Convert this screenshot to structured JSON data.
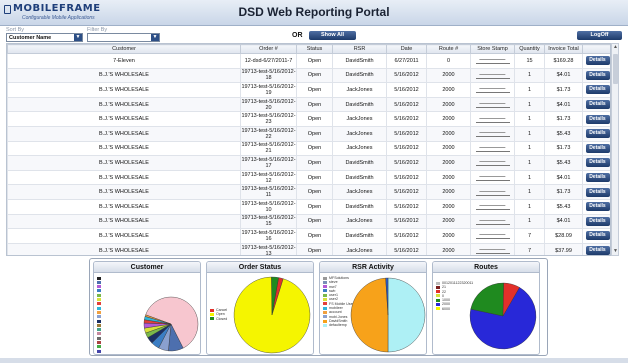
{
  "header": {
    "logo_text": "MOBILEFRAME",
    "logo_tagline": "Configurable Mobile Applications",
    "title": "DSD Web Reporting Portal"
  },
  "controls": {
    "sort_label": "Sort By",
    "sort_value": "Customer Name",
    "filter_label": "Filter By",
    "filter_value": "",
    "or_label": "OR",
    "show_all": "Show All",
    "logoff": "LogOff"
  },
  "table": {
    "columns": [
      "Customer",
      "Order #",
      "Status",
      "RSR",
      "Date",
      "Route #",
      "Store Stamp",
      "Quantity",
      "Invoice Total",
      ""
    ],
    "rows": [
      {
        "customer": "7-Eleven",
        "order": "12-dsd-6/27/2011-7",
        "status": "Open",
        "rsr": "DavidSmith",
        "date": "6/27/2011",
        "route": "0",
        "qty": "15",
        "total": "$169.28"
      },
      {
        "customer": "B.J.'S WHOLESALE",
        "order": "19713-test-5/16/2012-18",
        "status": "Open",
        "rsr": "DavidSmith",
        "date": "5/16/2012",
        "route": "2000",
        "qty": "1",
        "total": "$4.01"
      },
      {
        "customer": "B.J.'S WHOLESALE",
        "order": "19713-test-5/16/2012-19",
        "status": "Open",
        "rsr": "JackJones",
        "date": "5/16/2012",
        "route": "2000",
        "qty": "1",
        "total": "$1.73"
      },
      {
        "customer": "B.J.'S WHOLESALE",
        "order": "19713-test-5/16/2012-20",
        "status": "Open",
        "rsr": "DavidSmith",
        "date": "5/16/2012",
        "route": "2000",
        "qty": "1",
        "total": "$4.01"
      },
      {
        "customer": "B.J.'S WHOLESALE",
        "order": "19713-test-5/16/2012-23",
        "status": "Open",
        "rsr": "JackJones",
        "date": "5/16/2012",
        "route": "2000",
        "qty": "1",
        "total": "$1.73"
      },
      {
        "customer": "B.J.'S WHOLESALE",
        "order": "19713-test-5/16/2012-22",
        "status": "Open",
        "rsr": "JackJones",
        "date": "5/16/2012",
        "route": "2000",
        "qty": "1",
        "total": "$5.43"
      },
      {
        "customer": "B.J.'S WHOLESALE",
        "order": "19713-test-5/16/2012-21",
        "status": "Open",
        "rsr": "JackJones",
        "date": "5/16/2012",
        "route": "2000",
        "qty": "1",
        "total": "$1.73"
      },
      {
        "customer": "B.J.'S WHOLESALE",
        "order": "19713-test-5/16/2012-17",
        "status": "Open",
        "rsr": "DavidSmith",
        "date": "5/16/2012",
        "route": "2000",
        "qty": "1",
        "total": "$5.43"
      },
      {
        "customer": "B.J.'S WHOLESALE",
        "order": "19713-test-5/16/2012-12",
        "status": "Open",
        "rsr": "DavidSmith",
        "date": "5/16/2012",
        "route": "2000",
        "qty": "1",
        "total": "$4.01"
      },
      {
        "customer": "B.J.'S WHOLESALE",
        "order": "19713-test-5/16/2012-11",
        "status": "Open",
        "rsr": "JackJones",
        "date": "5/16/2012",
        "route": "2000",
        "qty": "1",
        "total": "$1.73"
      },
      {
        "customer": "B.J.'S WHOLESALE",
        "order": "19713-test-5/16/2012-10",
        "status": "Open",
        "rsr": "DavidSmith",
        "date": "5/16/2012",
        "route": "2000",
        "qty": "1",
        "total": "$5.43"
      },
      {
        "customer": "B.J.'S WHOLESALE",
        "order": "19713-test-5/16/2012-15",
        "status": "Open",
        "rsr": "JackJones",
        "date": "5/16/2012",
        "route": "2000",
        "qty": "1",
        "total": "$4.01"
      },
      {
        "customer": "B.J.'S WHOLESALE",
        "order": "19713-test-5/16/2012-16",
        "status": "Open",
        "rsr": "DavidSmith",
        "date": "5/16/2012",
        "route": "2000",
        "qty": "7",
        "total": "$28.09"
      },
      {
        "customer": "B.J.'S WHOLESALE",
        "order": "19713-test-5/16/2012-13",
        "status": "Open",
        "rsr": "JackJones",
        "date": "5/16/2012",
        "route": "2000",
        "qty": "7",
        "total": "$37.99"
      }
    ],
    "details_label": "Details"
  },
  "charts": {
    "customer": {
      "title": "Customer",
      "slices": [
        {
          "color": "#f7c6cf",
          "value": 62
        },
        {
          "color": "#4d6fae",
          "value": 9
        },
        {
          "color": "#8aa0cf",
          "value": 6
        },
        {
          "color": "#3b7dc4",
          "value": 5
        },
        {
          "color": "#1b2f64",
          "value": 4
        },
        {
          "color": "#7ab84a",
          "value": 3
        },
        {
          "color": "#d7e23a",
          "value": 3
        },
        {
          "color": "#b35ad6",
          "value": 3
        },
        {
          "color": "#e2403a",
          "value": 2
        },
        {
          "color": "#2fb5d9",
          "value": 2
        },
        {
          "color": "#f0a040",
          "value": 1
        }
      ],
      "legend_colors": [
        "#222",
        "#4d6fae",
        "#b35ad6",
        "#3b7dc4",
        "#7ab84a",
        "#d7e23a",
        "#e2403a",
        "#2fb5d9",
        "#f0a040",
        "#8aa0cf",
        "#1b2f64",
        "#9a7b3a",
        "#45a08a",
        "#c48aa0",
        "#6a6a6a",
        "#aa4444",
        "#44aa44",
        "#4444aa",
        "#aaaa44",
        "#44aaaa",
        "#aa44aa",
        "#f7c6cf"
      ]
    },
    "order_status": {
      "title": "Order Status",
      "slices": [
        {
          "label": "Cancel",
          "color": "#e2302a",
          "value": 2
        },
        {
          "label": "Open",
          "color": "#f5f500",
          "value": 95
        },
        {
          "label": "Closed",
          "color": "#1f8a1f",
          "value": 3
        }
      ]
    },
    "rsr_activity": {
      "title": "RSR Activity",
      "slices": [
        {
          "color": "#aef0f5",
          "value": 50
        },
        {
          "color": "#f7a21a",
          "value": 49
        },
        {
          "color": "#2a5ccc",
          "value": 1
        }
      ],
      "legend": [
        {
          "label": "MFSolutions",
          "color": "#999"
        },
        {
          "label": "steve",
          "color": "#7a8fb8"
        },
        {
          "label": "mw7",
          "color": "#b35ad6"
        },
        {
          "label": "swb",
          "color": "#3b7dc4"
        },
        {
          "label": "user1",
          "color": "#7ab84a"
        },
        {
          "label": "user2",
          "color": "#d7e23a"
        },
        {
          "label": "FS Mobile User",
          "color": "#e2403a"
        },
        {
          "label": "mobileer",
          "color": "#2fb5d9"
        },
        {
          "label": "account",
          "color": "#f0a040"
        },
        {
          "label": "mobi.Jones",
          "color": "#8aa0cf"
        },
        {
          "label": "DavidSmith",
          "color": "#f7a21a"
        },
        {
          "label": "defaultemp",
          "color": "#aef0f5"
        }
      ]
    },
    "routes": {
      "title": "Routes",
      "slices": [
        {
          "color": "#2828d8",
          "value": 70
        },
        {
          "color": "#1f8a1f",
          "value": 22
        },
        {
          "color": "#e2302a",
          "value": 8
        }
      ],
      "legend": [
        {
          "label": "0012011122320011",
          "color": "#bbbbbb"
        },
        {
          "label": "21",
          "color": "#7a1f1f"
        },
        {
          "label": "22",
          "color": "#e2302a"
        },
        {
          "label": "0",
          "color": "#d7e23a"
        },
        {
          "label": "1000",
          "color": "#1f8a1f"
        },
        {
          "label": "2000",
          "color": "#2828d8"
        },
        {
          "label": "6000",
          "color": "#f5f500"
        }
      ]
    }
  }
}
